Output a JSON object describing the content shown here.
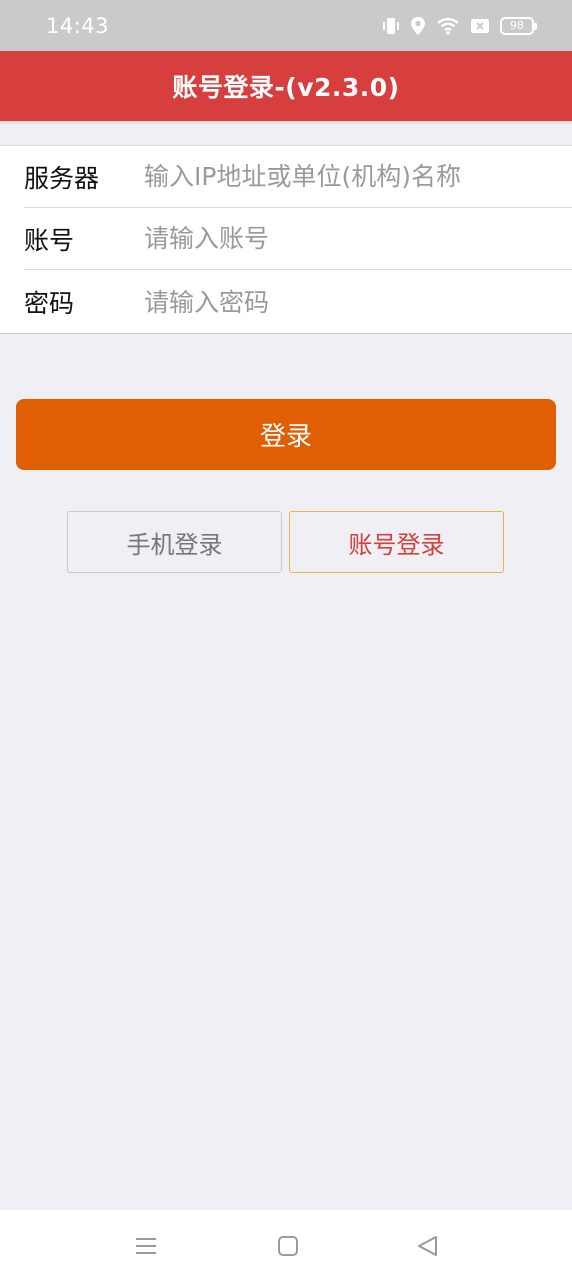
{
  "status_bar": {
    "time": "14:43",
    "battery": "98",
    "icons": [
      "vibrate-icon",
      "location-icon",
      "wifi-icon",
      "sim-x-icon",
      "battery-icon"
    ]
  },
  "header": {
    "title": "账号登录-(v2.3.0)",
    "color": "#d63f3d"
  },
  "form": {
    "server": {
      "label": "服务器",
      "placeholder": "输入IP地址或单位(机构)名称",
      "value": ""
    },
    "account": {
      "label": "账号",
      "placeholder": "请输入账号",
      "value": ""
    },
    "password": {
      "label": "密码",
      "placeholder": "请输入密码",
      "value": ""
    }
  },
  "login_button": {
    "label": "登录",
    "color": "#e05e04"
  },
  "login_modes": {
    "phone": {
      "label": "手机登录",
      "selected": false
    },
    "account": {
      "label": "账号登录",
      "selected": true
    }
  },
  "nav_bar": {
    "icons": [
      "menu-icon",
      "home-icon",
      "back-icon"
    ]
  }
}
